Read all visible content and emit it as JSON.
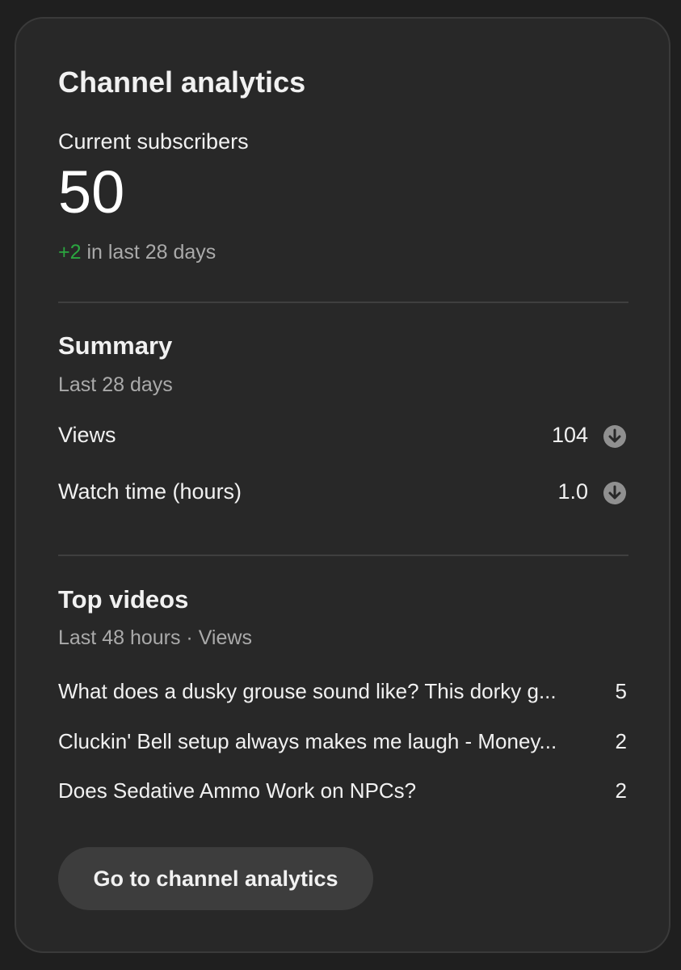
{
  "card": {
    "title": "Channel analytics"
  },
  "subscribers": {
    "label": "Current subscribers",
    "count": "50",
    "change_delta": "+2",
    "change_period": " in last 28 days"
  },
  "summary": {
    "title": "Summary",
    "period": "Last 28 days",
    "rows": [
      {
        "label": "Views",
        "value": "104",
        "trend_icon": "arrow-down-circle-icon"
      },
      {
        "label": "Watch time (hours)",
        "value": "1.0",
        "trend_icon": "arrow-down-circle-icon"
      }
    ]
  },
  "top_videos": {
    "title": "Top videos",
    "subtitle": "Last 48 hours · Views",
    "items": [
      {
        "title": "What does a dusky grouse sound like? This dorky g...",
        "views": "5"
      },
      {
        "title": "Cluckin' Bell setup always makes me laugh - Money...",
        "views": "2"
      },
      {
        "title": "Does Sedative Ammo Work on NPCs?",
        "views": "2"
      }
    ]
  },
  "actions": {
    "go_label": "Go to channel analytics"
  },
  "colors": {
    "background": "#282828",
    "positive": "#2ba640",
    "muted": "#aaaaaa",
    "button": "#3d3d3d"
  }
}
